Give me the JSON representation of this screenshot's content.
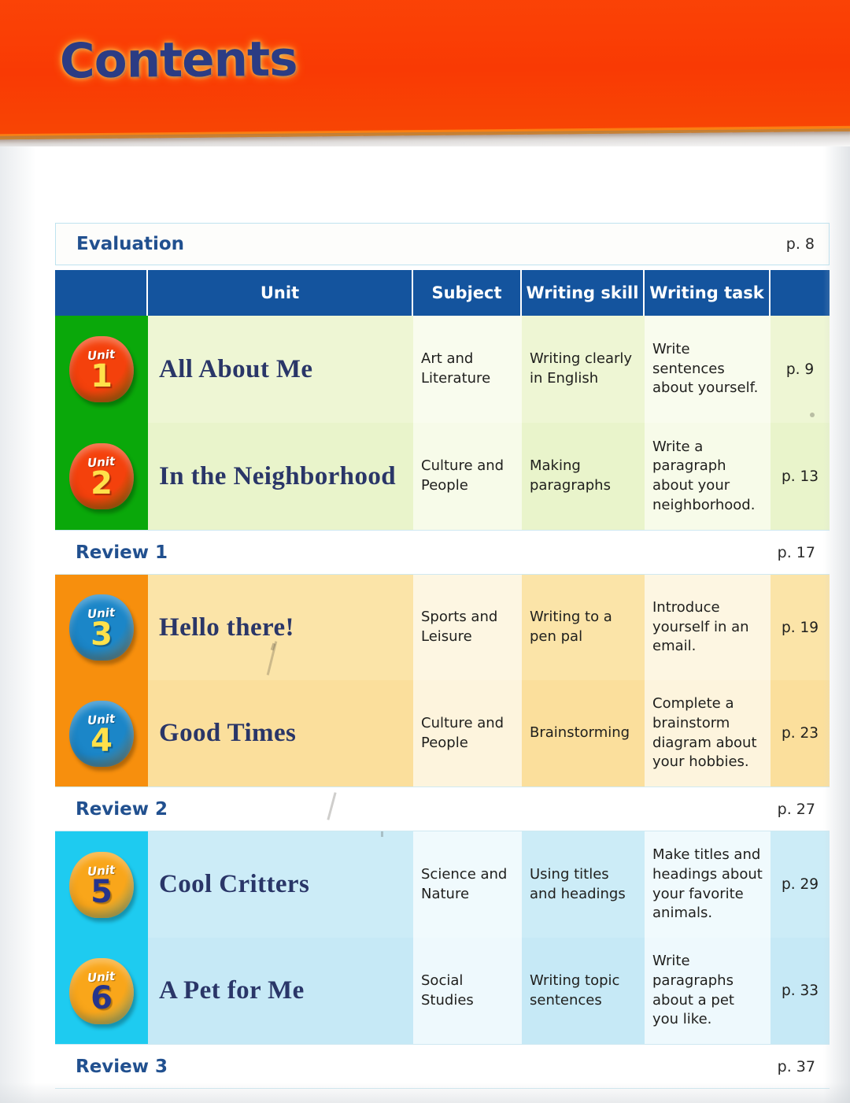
{
  "banner": {
    "title": "Contents",
    "bg_color": "#f93a04",
    "title_color": "#2b3c84"
  },
  "evaluation": {
    "label": "Evaluation",
    "page": "p. 8"
  },
  "table": {
    "headers": {
      "badge": "",
      "unit": "Unit",
      "subject": "Subject",
      "writing_skill": "Writing skill",
      "writing_task": "Writing task",
      "page": ""
    },
    "header_bg": "#14549e",
    "rows": [
      {
        "kind": "unit",
        "badge_word": "Unit",
        "badge_number": "1",
        "title": "All About Me",
        "subject": "Art and Literature",
        "writing_skill": "Writing clearly in English",
        "writing_task": "Write sentences about yourself.",
        "page": "p. 9",
        "band_color": "#0aa80a",
        "badge_color": "#f4410c",
        "badge_word_color": "#ffffff",
        "badge_number_color": "#ffe14a",
        "row_tint_a": "#eef6d4",
        "row_tint_b": "#f9fcee"
      },
      {
        "kind": "unit",
        "badge_word": "Unit",
        "badge_number": "2",
        "title": "In the Neighborhood",
        "subject": "Culture and People",
        "writing_skill": "Making paragraphs",
        "writing_task": "Write a paragraph about your neighborhood.",
        "page": "p. 13",
        "band_color": "#0aa80a",
        "badge_color": "#f4410c",
        "badge_word_color": "#ffffff",
        "badge_number_color": "#ffe14a",
        "row_tint_a": "#e9f4cb",
        "row_tint_b": "#f7fbe9"
      },
      {
        "kind": "review",
        "label": "Review 1",
        "page": "p. 17"
      },
      {
        "kind": "unit",
        "badge_word": "Unit",
        "badge_number": "3",
        "title": "Hello there!",
        "subject": "Sports and Leisure",
        "writing_skill": "Writing to a pen pal",
        "writing_task": "Introduce yourself in an email.",
        "page": "p. 19",
        "band_color": "#f78f0d",
        "badge_color": "#1b86c8",
        "badge_word_color": "#ffffff",
        "badge_number_color": "#ffe14a",
        "row_tint_a": "#fbe4a8",
        "row_tint_b": "#fdf6e2"
      },
      {
        "kind": "unit",
        "badge_word": "Unit",
        "badge_number": "4",
        "title": "Good Times",
        "subject": "Culture and People",
        "writing_skill": "Brainstorming",
        "writing_task": "Complete a brainstorm diagram about your hobbies.",
        "page": "p. 23",
        "band_color": "#f78f0d",
        "badge_color": "#1b86c8",
        "badge_word_color": "#ffffff",
        "badge_number_color": "#ffe14a",
        "row_tint_a": "#fbdf9c",
        "row_tint_b": "#fdf4dd"
      },
      {
        "kind": "review",
        "label": "Review 2",
        "page": "p. 27"
      },
      {
        "kind": "unit",
        "badge_word": "Unit",
        "badge_number": "5",
        "title": "Cool Critters",
        "subject": "Science and Nature",
        "writing_skill": "Using titles and headings",
        "writing_task": "Make titles and headings about your favorite animals.",
        "page": "p. 29",
        "band_color": "#1ecbf0",
        "badge_color": "#f9a61a",
        "badge_word_color": "#ffffff",
        "badge_number_color": "#26348c",
        "row_tint_a": "#ccecf7",
        "row_tint_b": "#f0fafd"
      },
      {
        "kind": "unit",
        "badge_word": "Unit",
        "badge_number": "6",
        "title": "A Pet for Me",
        "subject": "Social Studies",
        "writing_skill": "Writing topic sentences",
        "writing_task": "Write paragraphs about a pet you like.",
        "page": "p. 33",
        "band_color": "#1ecbf0",
        "badge_color": "#f9a61a",
        "badge_word_color": "#ffffff",
        "badge_number_color": "#26348c",
        "row_tint_a": "#c6e9f6",
        "row_tint_b": "#eef9fd"
      },
      {
        "kind": "review",
        "label": "Review 3",
        "page": "p. 37"
      }
    ]
  }
}
